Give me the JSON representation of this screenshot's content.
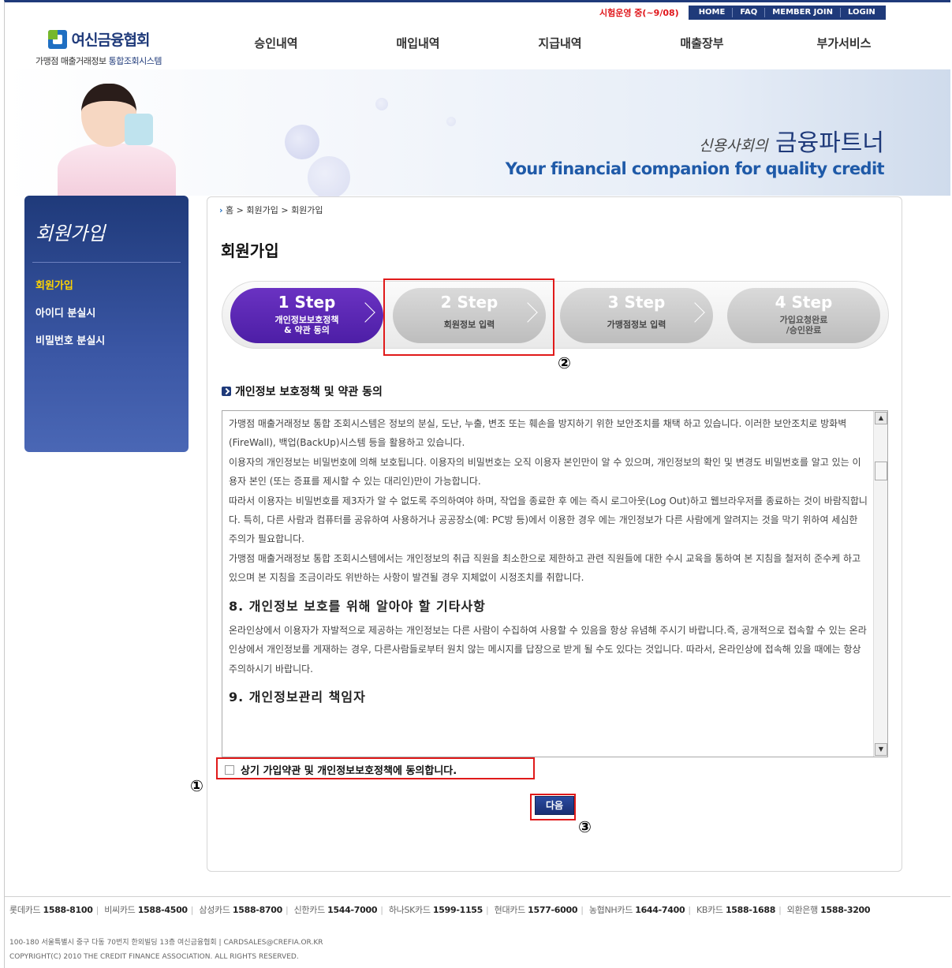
{
  "util": {
    "notice": "시험운영 중(~9/08)",
    "links": [
      "HOME",
      "FAQ",
      "MEMBER JOIN",
      "LOGIN"
    ]
  },
  "logo": {
    "name": "여신금융협회",
    "sub_plain": "가맹점 매출거래정보",
    "sub_accent": "통합조회시스템"
  },
  "gnb": [
    "승인내역",
    "매입내역",
    "지급내역",
    "매출장부",
    "부가서비스"
  ],
  "visual": {
    "slogan_small": "신용사회의",
    "slogan_big": "금융파트너",
    "slogan_en": "Your financial companion for quality credit"
  },
  "lnb": {
    "title": "회원가입",
    "items": [
      {
        "label": "회원가입",
        "active": true
      },
      {
        "label": "아이디 분실시"
      },
      {
        "label": "비밀번호 분실시"
      }
    ]
  },
  "breadcrumb": {
    "arrow": "›",
    "path": "홈 > 회원가입 > 회원가입"
  },
  "page_title": "회원가입",
  "steps": [
    {
      "num": "1 Step",
      "line1": "개인정보보호정책",
      "line2": "& 약관 동의",
      "active": true
    },
    {
      "num": "2 Step",
      "line1": "회원정보 입력",
      "line2": ""
    },
    {
      "num": "3 Step",
      "line1": "가맹점정보 입력",
      "line2": ""
    },
    {
      "num": "4 Step",
      "line1": "가입요청완료",
      "line2": "/승인완료"
    }
  ],
  "markers": {
    "m1": "①",
    "m2": "②",
    "m3": "③"
  },
  "section_title": "개인정보 보호정책 및 약관 동의",
  "terms": {
    "p1": "가맹점 매출거래정보 통합 조회시스템은 정보의 분실, 도난, 누출, 변조 또는 훼손을 방지하기 위한 보안조치를 채택 하고 있습니다. 이러한 보안조치로 방화벽(FireWall), 백업(BackUp)시스템 등을 활용하고 있습니다.",
    "p2": "이용자의 개인정보는 비밀번호에 의해 보호됩니다. 이용자의 비밀번호는 오직 이용자 본인만이 알 수 있으며, 개인정보의 확인 및 변경도 비밀번호를 알고 있는 이용자 본인 (또는 증표를 제시할 수 있는 대리인)만이 가능합니다.",
    "p3": "따라서 이용자는 비밀번호를 제3자가 알 수 없도록 주의하여야 하며, 작업을 종료한 후 에는 즉시 로그아웃(Log Out)하고 웹브라우저를 종료하는 것이 바람직합니다. 특히, 다른 사람과 컴퓨터를 공유하여 사용하거나 공공장소(예: PC방 등)에서 이용한 경우 에는 개인정보가 다른 사람에게 알려지는 것을 막기 위하여 세심한 주의가 필요합니다.",
    "p4": "가맹점 매출거래정보 통합 조회시스템에서는 개인정보의 취급 직원을 최소한으로 제한하고 관련 직원들에 대한 수시 교육을 통하여 본 지침을 철저히 준수케 하고 있으며 본 지침을 조금이라도 위반하는 사항이 발견될 경우 지체없이 시정조치를 취합니다.",
    "h8": "8. 개인정보 보호를 위해 알아야 할 기타사항",
    "p5": "온라인상에서 이용자가 자발적으로 제공하는 개인정보는 다른 사람이 수집하여 사용할 수 있음을 항상 유념해 주시기 바랍니다.즉, 공개적으로 접속할 수 있는 온라인상에서 개인정보를 게재하는 경우, 다른사람들로부터 원치 않는 메시지를 답장으로 받게 될 수도 있다는 것입니다. 따라서, 온라인상에 접속해 있을 때에는 항상 주의하시기 바랍니다.",
    "h9": "9. 개인정보관리 책임자"
  },
  "agree_label": "상기 가입약관 및 개인정보보호정책에 동의합니다.",
  "next_label": "다음",
  "footer": {
    "phones": [
      {
        "name": "롯데카드",
        "tel": "1588-8100"
      },
      {
        "name": "비씨카드",
        "tel": "1588-4500"
      },
      {
        "name": "삼성카드",
        "tel": "1588-8700"
      },
      {
        "name": "신한카드",
        "tel": "1544-7000"
      },
      {
        "name": "하나SK카드",
        "tel": "1599-1155"
      },
      {
        "name": "현대카드",
        "tel": "1577-6000"
      },
      {
        "name": "농협NH카드",
        "tel": "1644-7400"
      },
      {
        "name": "KB카드",
        "tel": "1588-1688"
      },
      {
        "name": "외환은행",
        "tel": "1588-3200"
      }
    ],
    "address": "100-180 서울특별시 중구 다동 70번지 한외빌딩 13층 여신금융협회  |  CARDSALES@CREFIA.OR.KR",
    "copyright": "COPYRIGHT(C) 2010 THE CREDIT FINANCE ASSOCIATION. ALL RIGHTS RESERVED."
  },
  "colors": {
    "brand": "#1f3a7a",
    "active_step": "#5a28b4",
    "notice": "#e0161b",
    "highlight": "#e01a1a"
  }
}
